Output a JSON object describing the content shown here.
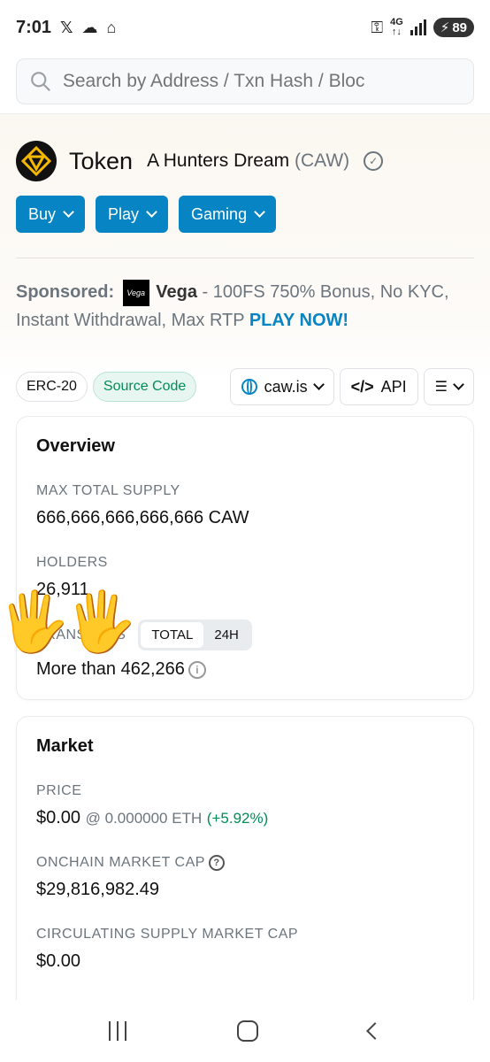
{
  "status": {
    "time": "7:01",
    "network": "4G",
    "battery": "89"
  },
  "search": {
    "placeholder": "Search by Address / Txn Hash / Bloc"
  },
  "token": {
    "title": "Token",
    "name": "A Hunters Dream",
    "symbol": "(CAW)"
  },
  "cta": [
    "Buy",
    "Play",
    "Gaming"
  ],
  "sponsor": {
    "label": "Sponsored:",
    "logo_text": "Vega",
    "brand": "Vega",
    "text": " - 100FS 750% Bonus, No KYC, Instant Withdrawal, Max RTP ",
    "cta": "PLAY NOW!"
  },
  "chips": {
    "standard": "ERC-20",
    "source": "Source Code",
    "site": "caw.is",
    "api": "API"
  },
  "overview": {
    "title": "Overview",
    "max_supply_label": "MAX TOTAL SUPPLY",
    "max_supply_value": "666,666,666,666,666 CAW",
    "holders_label": "HOLDERS",
    "holders_value": "26,911",
    "transfers_label": "TRANSFERS",
    "toggle_total": "TOTAL",
    "toggle_24h": "24H",
    "transfers_value": "More than 462,266"
  },
  "market": {
    "title": "Market",
    "price_label": "PRICE",
    "price_value": "$0.00",
    "price_eth": "@ 0.000000 ETH",
    "price_change": "(+5.92%)",
    "mcap_label": "ONCHAIN MARKET CAP",
    "mcap_value": "$29,816,982.49",
    "circ_label": "CIRCULATING SUPPLY MARKET CAP",
    "circ_value": "$0.00"
  },
  "overlay": {
    "emoji_left": "🖐️",
    "emoji_right": "🖐️"
  },
  "colors": {
    "primary": "#0784c3",
    "success": "#008d57"
  }
}
